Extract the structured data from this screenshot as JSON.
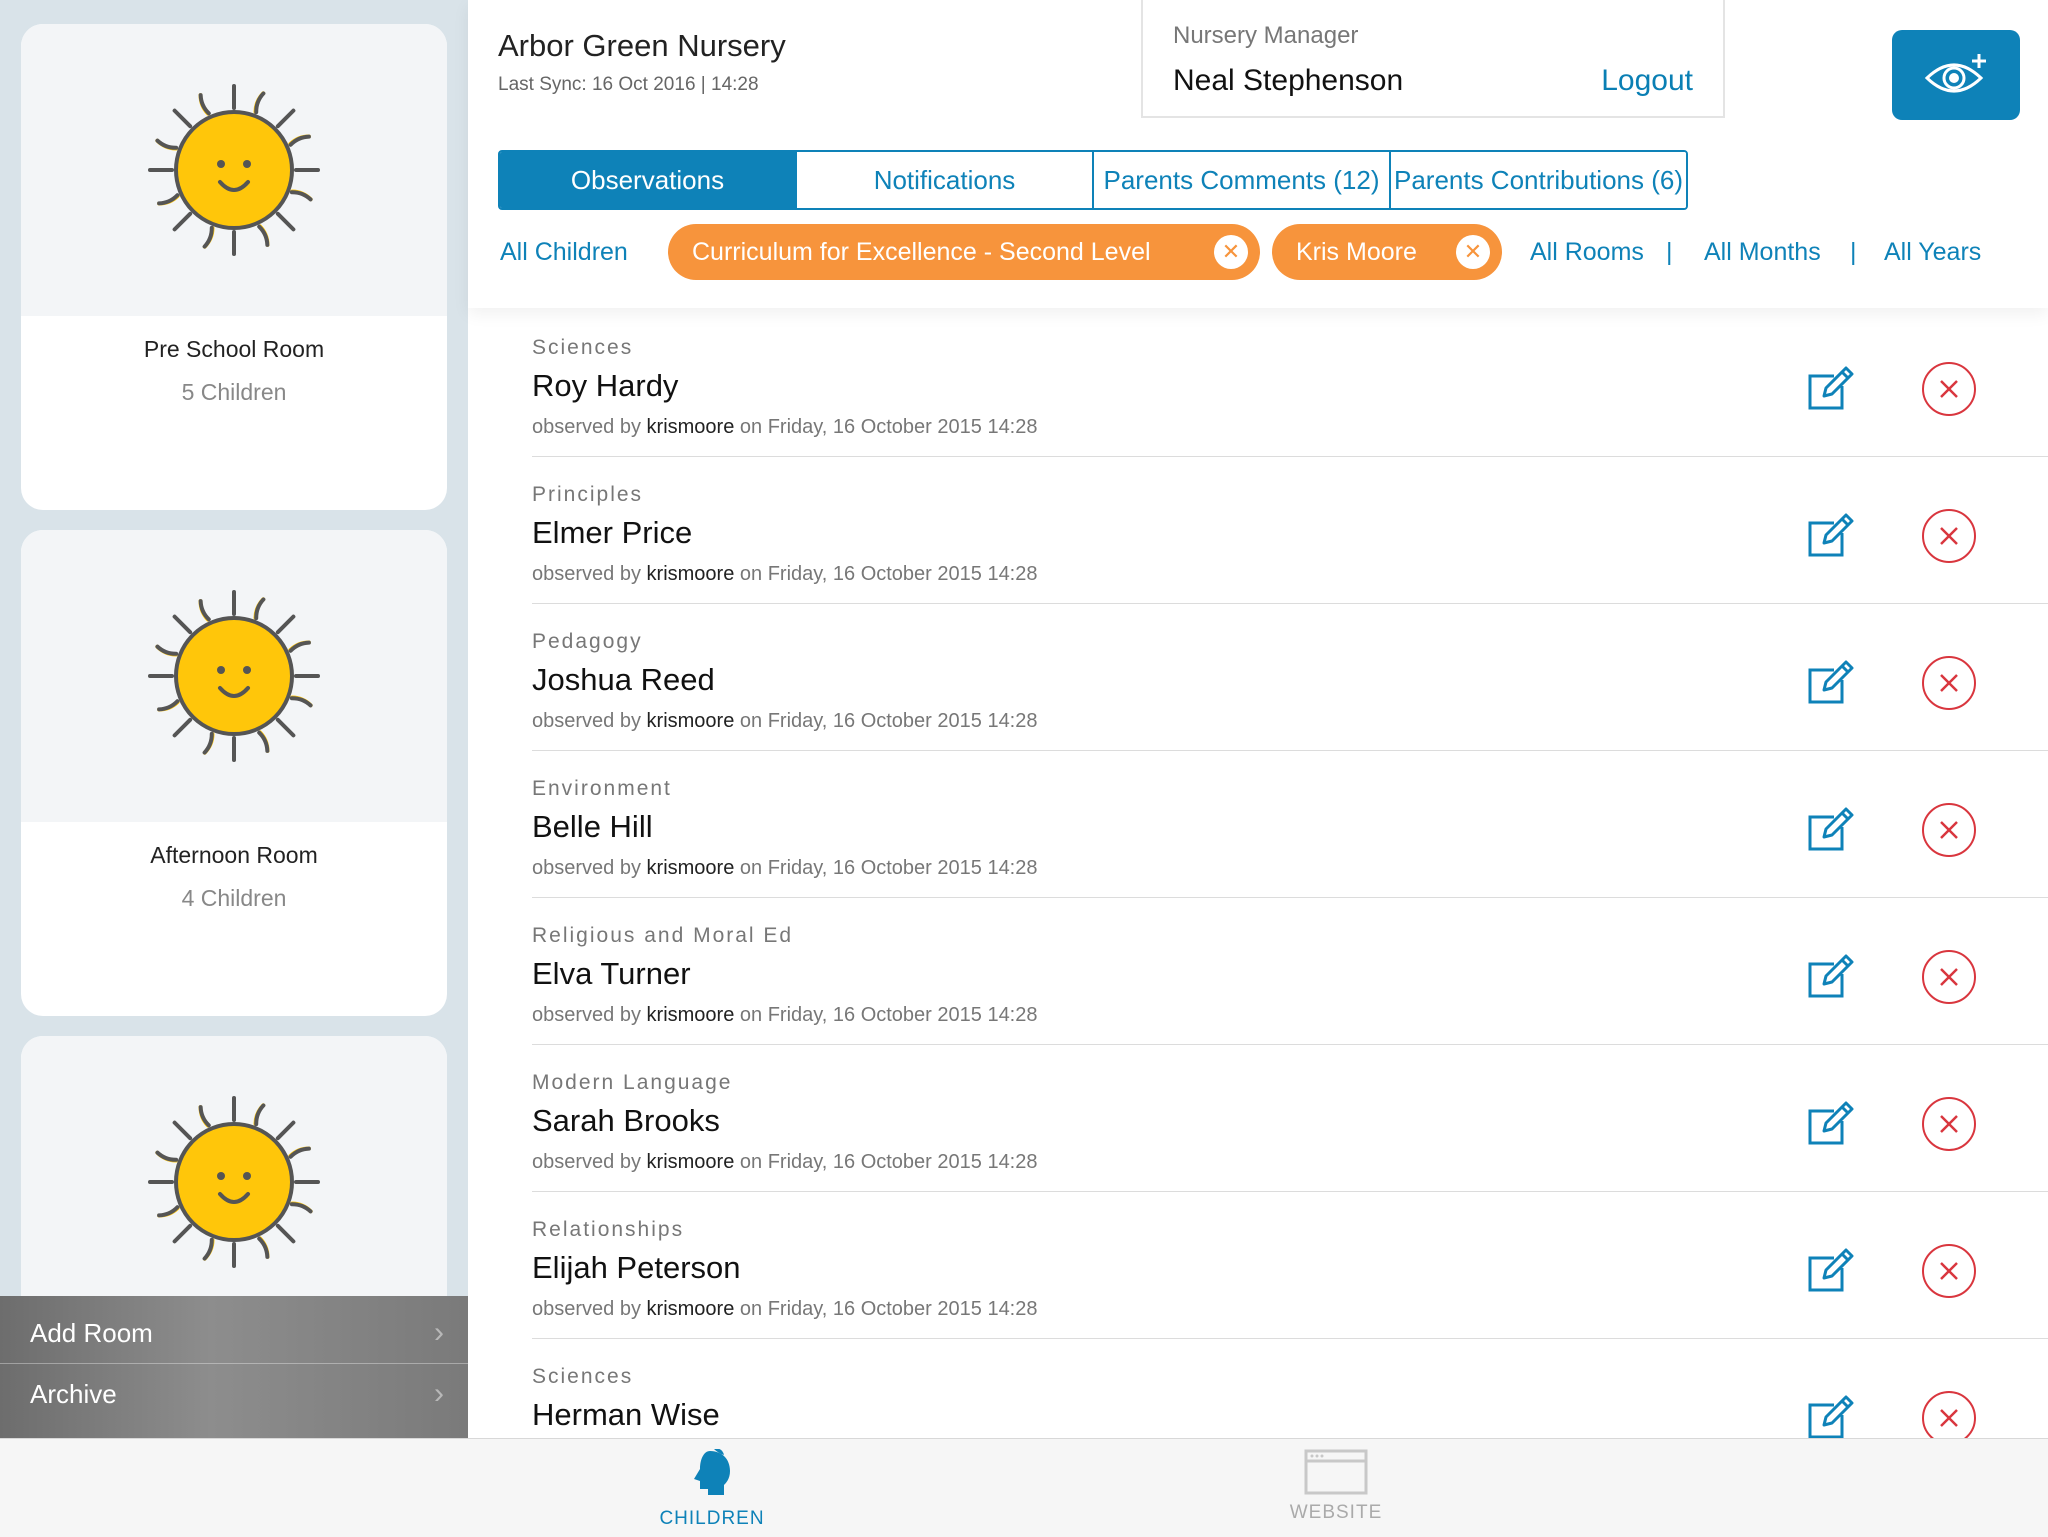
{
  "sidebar": {
    "rooms": [
      {
        "name": "Pre School Room",
        "count": "5 Children"
      },
      {
        "name": "Afternoon Room",
        "count": "4 Children"
      },
      {
        "name": "",
        "count": ""
      }
    ],
    "menu": [
      {
        "label": "Add Room",
        "icon": "chevron-right-icon"
      },
      {
        "label": "Archive",
        "icon": "chevron-right-icon"
      }
    ]
  },
  "header": {
    "title": "Arbor Green Nursery",
    "last_sync": "Last Sync: 16 Oct 2016 | 14:28",
    "role": "Nursery Manager",
    "user_name": "Neal Stephenson",
    "logout_label": "Logout",
    "eye_button_icon": "eye-plus-icon"
  },
  "tabs": [
    {
      "label": "Observations",
      "active": true
    },
    {
      "label": "Notifications",
      "active": false
    },
    {
      "label": "Parents Comments (12)",
      "active": false
    },
    {
      "label": "Parents Contributions (6)",
      "active": false
    }
  ],
  "filters": {
    "all_children": "All Children",
    "chips": [
      "Curriculum for Excellence - Second Level",
      "Kris Moore"
    ],
    "all_rooms": "All Rooms",
    "all_months": "All Months",
    "all_years": "All Years",
    "separator": "|"
  },
  "observations": [
    {
      "category": "Sciences",
      "child": "Roy Hardy",
      "prefix": "observed by",
      "user": "krismoore",
      "suffix": "on Friday, 16 October 2015 14:28"
    },
    {
      "category": "Principles",
      "child": "Elmer Price",
      "prefix": "observed by",
      "user": "krismoore",
      "suffix": "on Friday, 16 October 2015 14:28"
    },
    {
      "category": "Pedagogy",
      "child": "Joshua Reed",
      "prefix": "observed by",
      "user": "krismoore",
      "suffix": "on Friday, 16 October 2015 14:28"
    },
    {
      "category": "Environment",
      "child": "Belle Hill",
      "prefix": "observed by",
      "user": "krismoore",
      "suffix": "on Friday, 16 October 2015 14:28"
    },
    {
      "category": "Religious and Moral Ed",
      "child": "Elva Turner",
      "prefix": "observed by",
      "user": "krismoore",
      "suffix": "on Friday, 16 October 2015 14:28"
    },
    {
      "category": "Modern Language",
      "child": "Sarah Brooks",
      "prefix": "observed by",
      "user": "krismoore",
      "suffix": "on Friday, 16 October 2015 14:28"
    },
    {
      "category": "Relationships",
      "child": "Elijah Peterson",
      "prefix": "observed by",
      "user": "krismoore",
      "suffix": "on Friday, 16 October 2015 14:28"
    },
    {
      "category": "Sciences",
      "child": "Herman Wise",
      "prefix": "",
      "user": "",
      "suffix": ""
    }
  ],
  "bottom_tabs": [
    {
      "label": "CHILDREN",
      "icon": "child-head-icon",
      "active": true
    },
    {
      "label": "WEBSITE",
      "icon": "browser-window-icon",
      "active": false
    }
  ],
  "colors": {
    "primary": "#0e82b8",
    "chip": "#f7943c",
    "delete": "#d9363e",
    "sidebar_bg": "#d9e3e9",
    "sun": "#ffc60a"
  }
}
